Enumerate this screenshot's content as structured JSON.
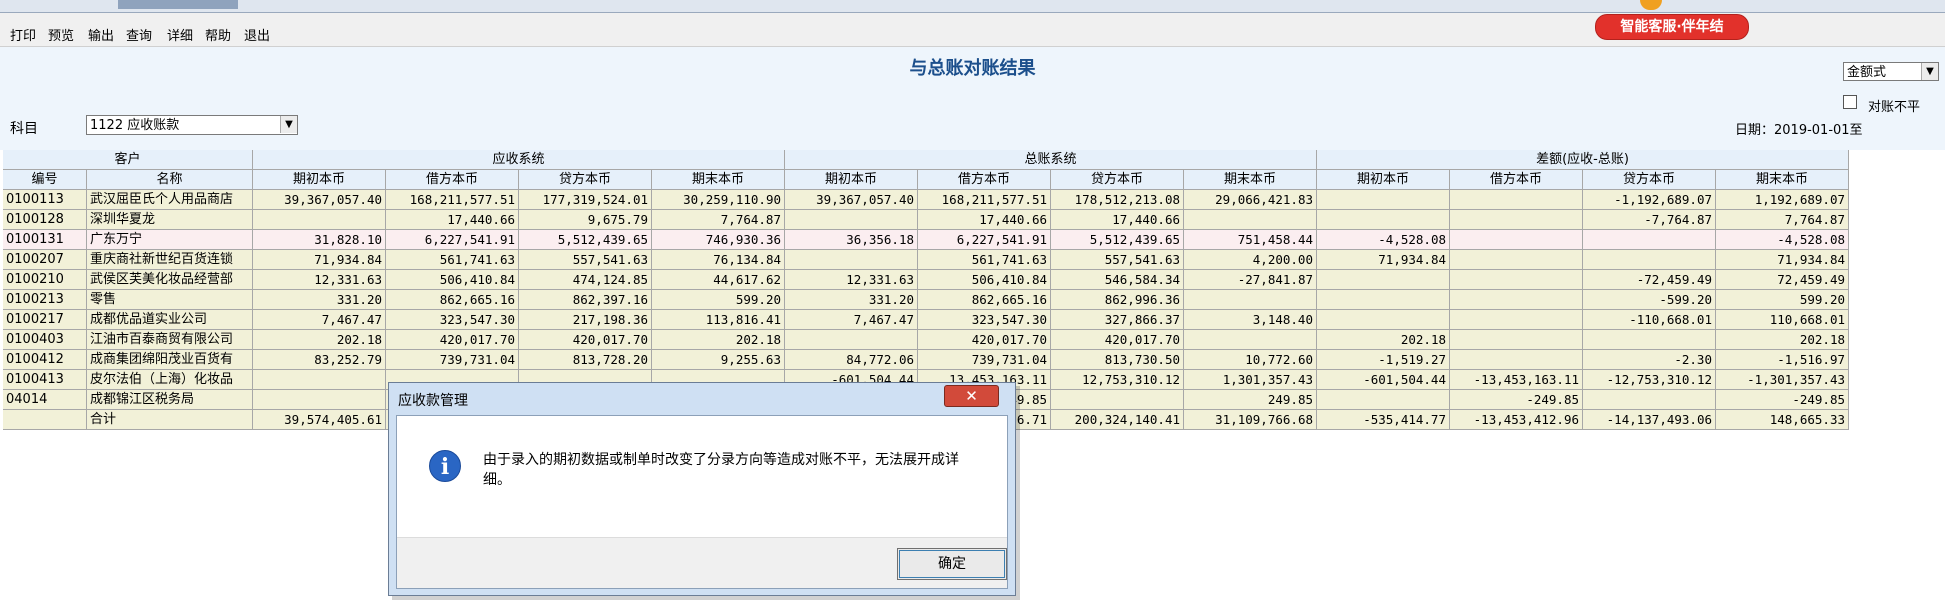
{
  "menu": [
    "打印",
    "预览",
    "输出",
    "查询",
    "详细",
    "帮助",
    "退出"
  ],
  "service_button": "智能客服·伴年结",
  "title": "与总账对账结果",
  "amount_mode": "金额式",
  "checkbox_label": "对账不平",
  "subject_label": "科目",
  "subject_value": "1122 应收账款",
  "date_label": "日期：2019-01-01至",
  "header_groups": [
    "客户",
    "应收系统",
    "总账系统",
    "差额(应收-总账)"
  ],
  "columns": [
    "编号",
    "名称",
    "期初本币",
    "借方本币",
    "贷方本币",
    "期末本币",
    "期初本币",
    "借方本币",
    "贷方本币",
    "期末本币",
    "期初本币",
    "借方本币",
    "贷方本币",
    "期末本币"
  ],
  "rows": [
    [
      "0100113",
      "武汉屈臣氏个人用品商店",
      "39,367,057.40",
      "168,211,577.51",
      "177,319,524.01",
      "30,259,110.90",
      "39,367,057.40",
      "168,211,577.51",
      "178,512,213.08",
      "29,066,421.83",
      "",
      "",
      "-1,192,689.07",
      "1,192,689.07"
    ],
    [
      "0100128",
      "深圳华夏龙",
      "",
      "17,440.66",
      "9,675.79",
      "7,764.87",
      "",
      "17,440.66",
      "17,440.66",
      "",
      "",
      "",
      "-7,764.87",
      "7,764.87"
    ],
    [
      "0100131",
      "广东万宁",
      "31,828.10",
      "6,227,541.91",
      "5,512,439.65",
      "746,930.36",
      "36,356.18",
      "6,227,541.91",
      "5,512,439.65",
      "751,458.44",
      "-4,528.08",
      "",
      "",
      "-4,528.08"
    ],
    [
      "0100207",
      "重庆商社新世纪百货连锁",
      "71,934.84",
      "561,741.63",
      "557,541.63",
      "76,134.84",
      "",
      "561,741.63",
      "557,541.63",
      "4,200.00",
      "71,934.84",
      "",
      "",
      "71,934.84"
    ],
    [
      "0100210",
      "武侯区芙美化妆品经营部",
      "12,331.63",
      "506,410.84",
      "474,124.85",
      "44,617.62",
      "12,331.63",
      "506,410.84",
      "546,584.34",
      "-27,841.87",
      "",
      "",
      "-72,459.49",
      "72,459.49"
    ],
    [
      "0100213",
      "零售",
      "331.20",
      "862,665.16",
      "862,397.16",
      "599.20",
      "331.20",
      "862,665.16",
      "862,996.36",
      "",
      "",
      "",
      "-599.20",
      "599.20"
    ],
    [
      "0100217",
      "成都优品道实业公司",
      "7,467.47",
      "323,547.30",
      "217,198.36",
      "113,816.41",
      "7,467.47",
      "323,547.30",
      "327,866.37",
      "3,148.40",
      "",
      "",
      "-110,668.01",
      "110,668.01"
    ],
    [
      "0100403",
      "江油市百泰商贸有限公司",
      "202.18",
      "420,017.70",
      "420,017.70",
      "202.18",
      "",
      "420,017.70",
      "420,017.70",
      "",
      "202.18",
      "",
      "",
      "202.18"
    ],
    [
      "0100412",
      "成商集团绵阳茂业百货有",
      "83,252.79",
      "739,731.04",
      "813,728.20",
      "9,255.63",
      "84,772.06",
      "739,731.04",
      "813,730.50",
      "10,772.60",
      "-1,519.27",
      "",
      "-2.30",
      "-1,516.97"
    ],
    [
      "0100413",
      "皮尔法伯（上海）化妆品",
      "",
      "",
      "",
      "",
      "-601,504.44",
      "13,453,163.11",
      "12,753,310.12",
      "1,301,357.43",
      "-601,504.44",
      "-13,453,163.11",
      "-12,753,310.12",
      "-1,301,357.43"
    ],
    [
      "04014",
      "成都锦江区税务局",
      "",
      "",
      "",
      "",
      "",
      "249.85",
      "",
      "249.85",
      "",
      "-249.85",
      "",
      "-249.85"
    ],
    [
      "",
      "合计",
      "39,574,405.61",
      "",
      "",
      "",
      "",
      "6.71",
      "200,324,140.41",
      "31,109,766.68",
      "-535,414.77",
      "-13,453,412.96",
      "-14,137,493.06",
      "148,665.33"
    ]
  ],
  "dialog": {
    "title": "应收款管理",
    "close": "✕",
    "message": "由于录入的期初数据或制单时改变了分录方向等造成对账不平，无法展开成详细。",
    "ok": "确定",
    "icon": "info-icon"
  }
}
